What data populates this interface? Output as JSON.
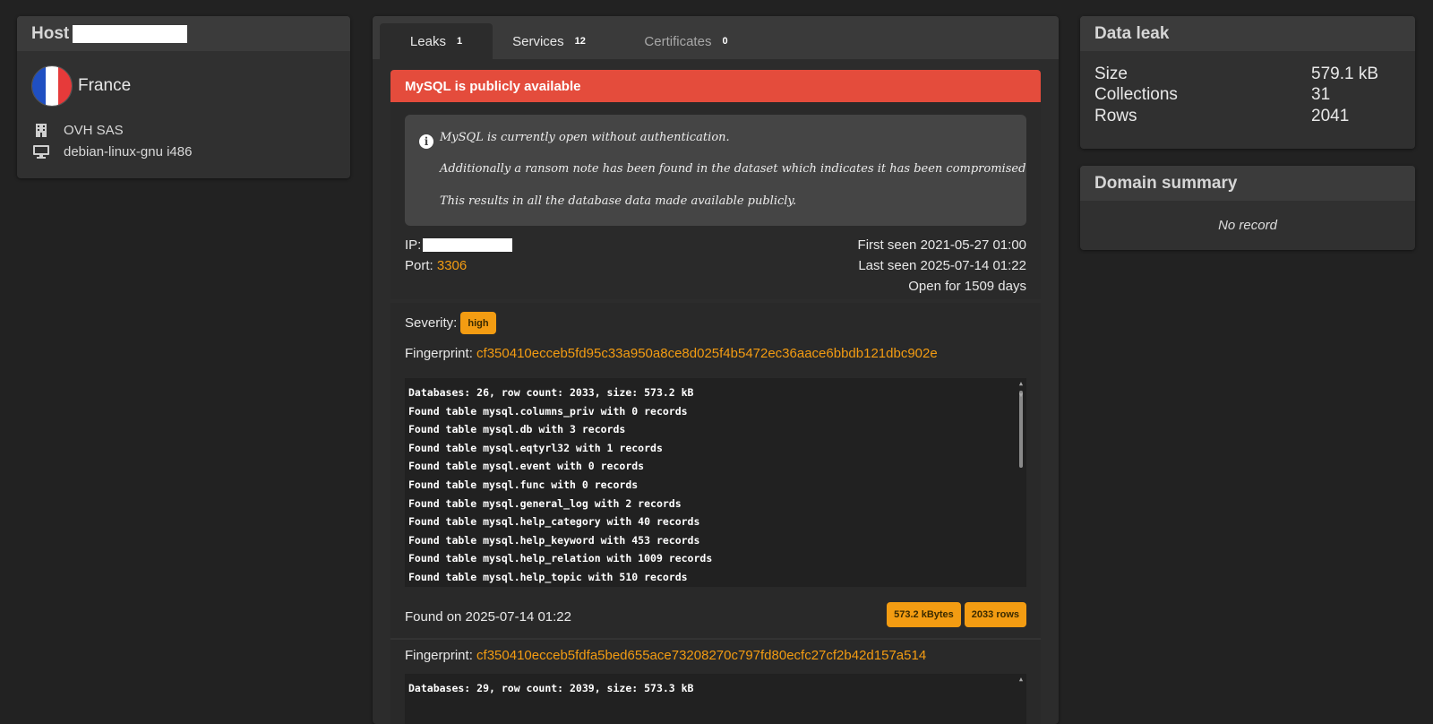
{
  "host": {
    "title": "Host",
    "country": "France",
    "flag_colors": [
      "#1f4fc2",
      "#ffffff",
      "#e63a3a"
    ],
    "org": "OVH SAS",
    "os": "debian-linux-gnu i486",
    "org_icon": "building-icon",
    "os_icon": "monitor-icon"
  },
  "tabs": [
    {
      "label": "Leaks",
      "count": "1"
    },
    {
      "label": "Services",
      "count": "12"
    },
    {
      "label": "Certificates",
      "count": "0"
    }
  ],
  "leak": {
    "alert_title": "MySQL is publicly available",
    "note_lines": [
      "MySQL is currently open without authentication.",
      "Additionally a ransom note has been found in the dataset which indicates it has been compromised",
      "This results in all the database data made available publicly."
    ],
    "ip_label": "IP:",
    "port_label": "Port:",
    "port": "3306",
    "first_seen": "First seen 2021-05-27 01:00",
    "last_seen": "Last seen 2025-07-14 01:22",
    "open_for": "Open for 1509 days",
    "severity_label": "Severity:",
    "severity": "high",
    "fingerprint_label": "Fingerprint:",
    "fingerprint_1": "cf350410ecceb5fd95c33a950a8ce8d025f4b5472ec36aace6bbdb121dbc902e",
    "log_1": [
      "Databases: 26, row count: 2033, size: 573.2 kB",
      "Found table mysql.columns_priv with 0 records",
      "Found table mysql.db with 3 records",
      "Found table mysql.eqtyrl32 with 1 records",
      "Found table mysql.event with 0 records",
      "Found table mysql.func with 0 records",
      "Found table mysql.general_log with 2 records",
      "Found table mysql.help_category with 40 records",
      "Found table mysql.help_keyword with 453 records",
      "Found table mysql.help_relation with 1009 records",
      "Found table mysql.help_topic with 510 records"
    ],
    "found_on": "Found on 2025-07-14 01:22",
    "size_badge": "573.2 kBytes",
    "rows_badge": "2033 rows",
    "fingerprint_2": "cf350410ecceb5fdfa5bed655ace73208270c797fd80ecfc27cf2b42d157a514",
    "log_2": [
      "Databases: 29, row count: 2039, size: 573.3 kB"
    ]
  },
  "data_leak": {
    "title": "Data leak",
    "rows": [
      {
        "k": "Size",
        "v": "579.1 kB"
      },
      {
        "k": "Collections",
        "v": "31"
      },
      {
        "k": "Rows",
        "v": "2041"
      }
    ]
  },
  "domain_summary": {
    "title": "Domain summary",
    "empty": "No record"
  },
  "colors": {
    "accent": "#f39c12",
    "alert": "#e44c3c",
    "background": "#222222"
  }
}
